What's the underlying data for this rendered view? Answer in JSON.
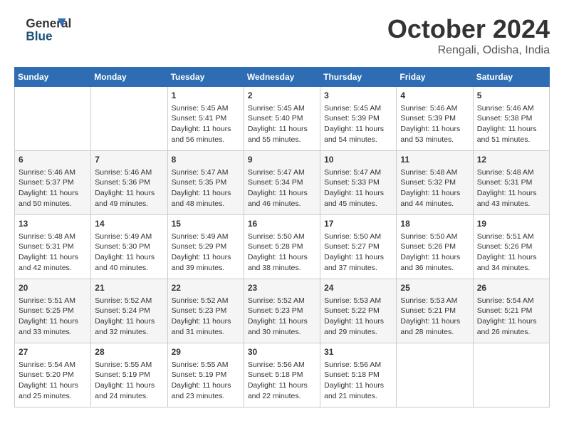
{
  "header": {
    "logo_general": "General",
    "logo_blue": "Blue",
    "month_title": "October 2024",
    "location": "Rengali, Odisha, India"
  },
  "days_of_week": [
    "Sunday",
    "Monday",
    "Tuesday",
    "Wednesday",
    "Thursday",
    "Friday",
    "Saturday"
  ],
  "weeks": [
    [
      {
        "day": "",
        "content": ""
      },
      {
        "day": "",
        "content": ""
      },
      {
        "day": "1",
        "content": "Sunrise: 5:45 AM\nSunset: 5:41 PM\nDaylight: 11 hours and 56 minutes."
      },
      {
        "day": "2",
        "content": "Sunrise: 5:45 AM\nSunset: 5:40 PM\nDaylight: 11 hours and 55 minutes."
      },
      {
        "day": "3",
        "content": "Sunrise: 5:45 AM\nSunset: 5:39 PM\nDaylight: 11 hours and 54 minutes."
      },
      {
        "day": "4",
        "content": "Sunrise: 5:46 AM\nSunset: 5:39 PM\nDaylight: 11 hours and 53 minutes."
      },
      {
        "day": "5",
        "content": "Sunrise: 5:46 AM\nSunset: 5:38 PM\nDaylight: 11 hours and 51 minutes."
      }
    ],
    [
      {
        "day": "6",
        "content": "Sunrise: 5:46 AM\nSunset: 5:37 PM\nDaylight: 11 hours and 50 minutes."
      },
      {
        "day": "7",
        "content": "Sunrise: 5:46 AM\nSunset: 5:36 PM\nDaylight: 11 hours and 49 minutes."
      },
      {
        "day": "8",
        "content": "Sunrise: 5:47 AM\nSunset: 5:35 PM\nDaylight: 11 hours and 48 minutes."
      },
      {
        "day": "9",
        "content": "Sunrise: 5:47 AM\nSunset: 5:34 PM\nDaylight: 11 hours and 46 minutes."
      },
      {
        "day": "10",
        "content": "Sunrise: 5:47 AM\nSunset: 5:33 PM\nDaylight: 11 hours and 45 minutes."
      },
      {
        "day": "11",
        "content": "Sunrise: 5:48 AM\nSunset: 5:32 PM\nDaylight: 11 hours and 44 minutes."
      },
      {
        "day": "12",
        "content": "Sunrise: 5:48 AM\nSunset: 5:31 PM\nDaylight: 11 hours and 43 minutes."
      }
    ],
    [
      {
        "day": "13",
        "content": "Sunrise: 5:48 AM\nSunset: 5:31 PM\nDaylight: 11 hours and 42 minutes."
      },
      {
        "day": "14",
        "content": "Sunrise: 5:49 AM\nSunset: 5:30 PM\nDaylight: 11 hours and 40 minutes."
      },
      {
        "day": "15",
        "content": "Sunrise: 5:49 AM\nSunset: 5:29 PM\nDaylight: 11 hours and 39 minutes."
      },
      {
        "day": "16",
        "content": "Sunrise: 5:50 AM\nSunset: 5:28 PM\nDaylight: 11 hours and 38 minutes."
      },
      {
        "day": "17",
        "content": "Sunrise: 5:50 AM\nSunset: 5:27 PM\nDaylight: 11 hours and 37 minutes."
      },
      {
        "day": "18",
        "content": "Sunrise: 5:50 AM\nSunset: 5:26 PM\nDaylight: 11 hours and 36 minutes."
      },
      {
        "day": "19",
        "content": "Sunrise: 5:51 AM\nSunset: 5:26 PM\nDaylight: 11 hours and 34 minutes."
      }
    ],
    [
      {
        "day": "20",
        "content": "Sunrise: 5:51 AM\nSunset: 5:25 PM\nDaylight: 11 hours and 33 minutes."
      },
      {
        "day": "21",
        "content": "Sunrise: 5:52 AM\nSunset: 5:24 PM\nDaylight: 11 hours and 32 minutes."
      },
      {
        "day": "22",
        "content": "Sunrise: 5:52 AM\nSunset: 5:23 PM\nDaylight: 11 hours and 31 minutes."
      },
      {
        "day": "23",
        "content": "Sunrise: 5:52 AM\nSunset: 5:23 PM\nDaylight: 11 hours and 30 minutes."
      },
      {
        "day": "24",
        "content": "Sunrise: 5:53 AM\nSunset: 5:22 PM\nDaylight: 11 hours and 29 minutes."
      },
      {
        "day": "25",
        "content": "Sunrise: 5:53 AM\nSunset: 5:21 PM\nDaylight: 11 hours and 28 minutes."
      },
      {
        "day": "26",
        "content": "Sunrise: 5:54 AM\nSunset: 5:21 PM\nDaylight: 11 hours and 26 minutes."
      }
    ],
    [
      {
        "day": "27",
        "content": "Sunrise: 5:54 AM\nSunset: 5:20 PM\nDaylight: 11 hours and 25 minutes."
      },
      {
        "day": "28",
        "content": "Sunrise: 5:55 AM\nSunset: 5:19 PM\nDaylight: 11 hours and 24 minutes."
      },
      {
        "day": "29",
        "content": "Sunrise: 5:55 AM\nSunset: 5:19 PM\nDaylight: 11 hours and 23 minutes."
      },
      {
        "day": "30",
        "content": "Sunrise: 5:56 AM\nSunset: 5:18 PM\nDaylight: 11 hours and 22 minutes."
      },
      {
        "day": "31",
        "content": "Sunrise: 5:56 AM\nSunset: 5:18 PM\nDaylight: 11 hours and 21 minutes."
      },
      {
        "day": "",
        "content": ""
      },
      {
        "day": "",
        "content": ""
      }
    ]
  ]
}
